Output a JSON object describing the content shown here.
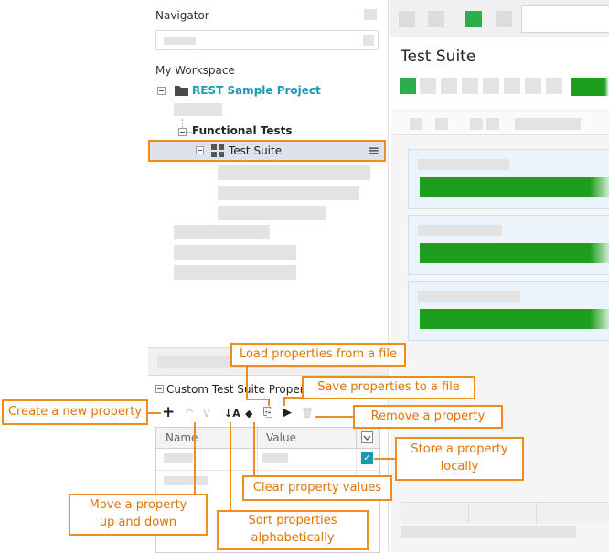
{
  "navigator": {
    "title": "Navigator",
    "workspace_label": "My Workspace",
    "project_name": "REST Sample Project",
    "functional_tests_label": "Functional Tests",
    "test_suite_label": "Test Suite",
    "menu_glyph": "≡"
  },
  "editor": {
    "title": "Test Suite"
  },
  "custom_props": {
    "title": "Custom Test Suite Properties",
    "columns": [
      "Name",
      "Value"
    ]
  },
  "callouts": {
    "load": "Load properties from a file",
    "save": "Save properties to a file",
    "create": "Create a new property",
    "remove": "Remove a property",
    "store_line1": "Store a property",
    "store_line2": "locally",
    "clear": "Clear property values",
    "move_line1": "Move a property",
    "move_line2": "up and down",
    "sort_line1": "Sort properties",
    "sort_line2": "alphabetically"
  },
  "icons": {
    "add": "+",
    "up": "^",
    "down": "v",
    "sort": "↓A",
    "clear": "◆",
    "load": "⎘",
    "save": "▶",
    "remove": "🗑",
    "check": "✓",
    "folder": "folder-icon",
    "suite": "test-suite-icon"
  },
  "colors": {
    "accent": "#f08c1e",
    "link": "#1a9ab0",
    "green": "#1e9e1e",
    "selection": "#dfe2e8"
  }
}
